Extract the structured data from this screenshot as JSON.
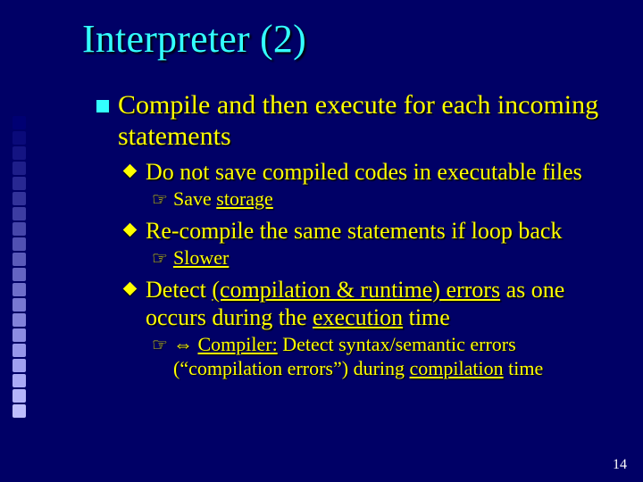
{
  "title": "Interpreter (2)",
  "bullets": {
    "b1": "Compile and then execute for each incoming statements",
    "b2a": "Do not save compiled codes in executable files",
    "b3a_pre": "Save ",
    "b3a_u": "storage",
    "b2b": "Re-compile the same statements if loop back",
    "b3b_u": "Slower",
    "b2c_pre": "Detect ",
    "b2c_u1": "(compilation & runtime) errors",
    "b2c_mid": " as one occurs during the ",
    "b2c_u2": "execution",
    "b2c_post": " time",
    "b3c_arrow": "⇔ ",
    "b3c_u1": "Compiler:",
    "b3c_mid": " Detect syntax/semantic errors (“compilation errors”) during ",
    "b3c_u2": "compilation",
    "b3c_post": " time"
  },
  "deco_colors": [
    "#000073",
    "#0a0a7a",
    "#141482",
    "#1e1e8a",
    "#282892",
    "#32329a",
    "#3c3ca2",
    "#4646aa",
    "#5050b2",
    "#5a5aba",
    "#6464c2",
    "#6e6eca",
    "#7878d2",
    "#8282da",
    "#8c8ce2",
    "#9696ea",
    "#a0a0f0",
    "#aaaaf6",
    "#b4b4fa",
    "#bebefe"
  ],
  "page_number": "14"
}
